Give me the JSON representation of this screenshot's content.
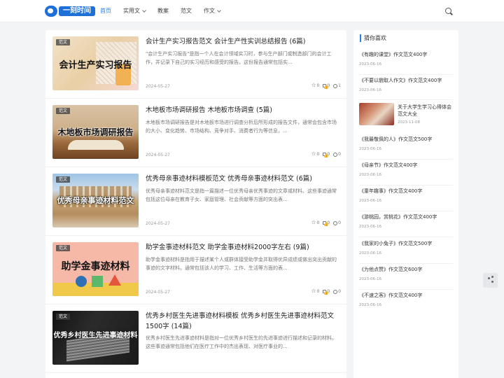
{
  "header": {
    "logo_text": "一刻时间",
    "nav": [
      {
        "label": "首页",
        "active": true,
        "dropdown": false
      },
      {
        "label": "实用文",
        "active": false,
        "dropdown": true
      },
      {
        "label": "教案",
        "active": false,
        "dropdown": false
      },
      {
        "label": "范文",
        "active": false,
        "dropdown": false
      },
      {
        "label": "作文",
        "active": false,
        "dropdown": true
      }
    ],
    "search_icon": "search-icon"
  },
  "posts": [
    {
      "badge": "范文",
      "thumb_text": "会计生产实习报告",
      "title": "会计生产实习报告范文 会计生产性实训总结报告 (6篇)",
      "excerpt": "\"会计生产实习报告\"是指一个人在会计领域实习时，参与生产部门或制造部门的会计工作，并记录下自己的实习经历和感受的报告。这份报告通常包括实...",
      "date": "2024-05-27",
      "stars": "0",
      "likes": "0",
      "comments": "1"
    },
    {
      "badge": "范文",
      "thumb_text": "木地板市场调研报告",
      "title": "木地板市场调研报告 木地板市场调查 (5篇)",
      "excerpt": "木地板市场调研报告是对木地板市场进行调查分析后所形成的报告文件，通常会包含市场的大小、变化趋势、市场结构、竞争对手、消费者行为等信息，...",
      "date": "2024-05-27",
      "stars": "0",
      "likes": "0",
      "comments": "0"
    },
    {
      "badge": "范文",
      "thumb_text": "优秀母亲事迹材料范文",
      "title": "优秀母亲事迹材料模板范文 优秀母亲事迹材料范文 (6篇)",
      "excerpt": "优秀母亲事迹材料范文是指一篇描述一位优秀母亲优秀事迹的文章或材料。这些事迹通常包括这位母亲在教育子女、家庭管理、社会贡献等方面的突出表...",
      "date": "2024-05-27",
      "stars": "0",
      "likes": "0",
      "comments": "0"
    },
    {
      "badge": "范文",
      "thumb_text": "助学金事迹材料",
      "title": "助学金事迹材料范文 助学金事迹材料2000字左右 (9篇)",
      "excerpt": "助学金事迹材料是指用于描述某个人或群体接受助学金并取得优异成绩或做出突出贡献的事迹的文字材料。通常包括该人的学习、工作、生活等方面的表...",
      "date": "2024-05-27",
      "stars": "0",
      "likes": "0",
      "comments": "0"
    },
    {
      "badge": "范文",
      "thumb_text": "优秀乡村医生先进事迹材料",
      "title": "优秀乡村医生先进事迹材料模板 优秀乡村医生先进事迹材料范文1500字 (14篇)",
      "excerpt": "优秀乡村医生先进事迹材料是指对一位优秀乡村医生的先进事迹进行描述和记录的材料。这些事迹通常包括他们在医疗工作中的杰出表现、对医疗事业的...",
      "date": "2024-05-27",
      "stars": "0",
      "likes": "0",
      "comments": "0"
    }
  ],
  "sidebar": {
    "title": "猜你喜欢",
    "items": [
      {
        "title": "《有趣的课堂》作文范文400字",
        "date": "2023-06-16"
      },
      {
        "title": "《不要以貌取人作文》作文范文400字",
        "date": "2023-06-16"
      },
      {
        "title": "关于大学生学习心得体会范文大全",
        "date": "2023-11-08",
        "has_thumb": true
      },
      {
        "title": "《我最敬佩的人》作文范文500字",
        "date": "2023-06-16"
      },
      {
        "title": "《母亲节》作文范文400字",
        "date": "2023-06-16"
      },
      {
        "title": "《童年趣事》作文范文400字",
        "date": "2023-06-16"
      },
      {
        "title": "《游桃园，赏桃花》作文范文400字",
        "date": "2023-06-16"
      },
      {
        "title": "《我家的小兔子》作文范文500字",
        "date": "2023-06-16"
      },
      {
        "title": "《为他点赞》作文范文600字",
        "date": "2023-06-16"
      },
      {
        "title": "《不速之客》作文范文400字",
        "date": "2023-06-16"
      }
    ]
  },
  "share_icon": "share-icon"
}
